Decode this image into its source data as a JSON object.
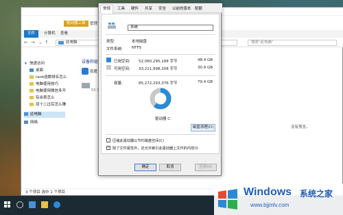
{
  "explorer": {
    "tabs": [
      "文件",
      "计算机",
      "查看"
    ],
    "ribbon_partial": [
      "驱动器工具",
      "管理"
    ],
    "address": "此电脑",
    "search_placeholder": "搜索\"此电脑\"",
    "group_header": "设备和驱动器",
    "device_name_partial": "百度",
    "device_size_partial": "53.7",
    "empty_text": "没有预览。",
    "status": "3 个项目   选中 1 个项目"
  },
  "sidebar": {
    "items": [
      {
        "label": "快速访问",
        "icon": "star-icon"
      },
      {
        "label": "桌面",
        "icon": "desktop-icon"
      },
      {
        "label": "rank函数排名怎么",
        "icon": "folder-icon"
      },
      {
        "label": "电脑使用技巧",
        "icon": "folder-icon"
      },
      {
        "label": "电脑使用微信多开",
        "icon": "folder-icon"
      },
      {
        "label": "有余表怎么",
        "icon": "folder-icon"
      },
      {
        "label": "双十二过后怎么赚",
        "icon": "folder-icon"
      },
      {
        "label": "此电脑",
        "icon": "pc-icon"
      },
      {
        "label": "网络",
        "icon": "network-icon"
      }
    ]
  },
  "properties": {
    "tabs": [
      "常规",
      "工具",
      "硬件",
      "共享",
      "安全",
      "以前的版本",
      "配额"
    ],
    "name": "系统",
    "type_label": "类型:",
    "type_value": "本地磁盘",
    "fs_label": "文件系统:",
    "fs_value": "NTFS",
    "used_label": "已用空间:",
    "used_bytes": "52,060,295,168 字节",
    "used_size": "48.4 GB",
    "free_label": "可用空间:",
    "free_bytes": "33,211,998,208 字节",
    "free_size": "30.9 GB",
    "capacity_label": "容量:",
    "capacity_bytes": "85,272,293,376 字节",
    "capacity_size": "79.4 GB",
    "drive_label": "驱动器 C:",
    "cleanup_button": "磁盘清理(D)",
    "compress_label": "压缩此驱动器以节约磁盘空间(C)",
    "index_label": "除了文件属性外，还允许索引此驱动器上文件的内容(I)",
    "compress_checked": false,
    "index_checked": true,
    "ok": "确定",
    "cancel": "取消",
    "apply": "应用(A)",
    "used_fraction": 0.61,
    "colors": {
      "used": "#2a8ad4",
      "free": "#c8c8c8"
    }
  },
  "watermark": {
    "brand": "Windows",
    "suffix": "系统之家",
    "url": "www.bjjmlv.com"
  }
}
